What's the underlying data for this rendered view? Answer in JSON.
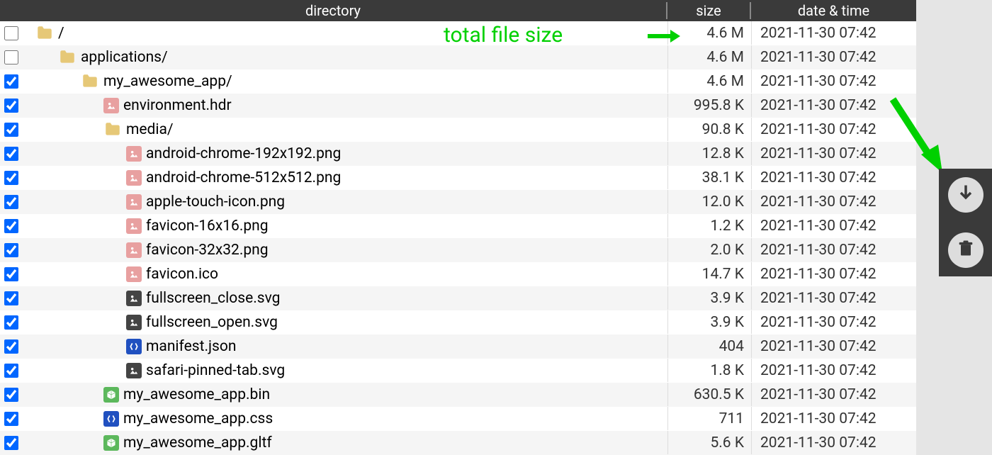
{
  "header": {
    "directory": "directory",
    "size": "size",
    "date": "date & time"
  },
  "annotation": {
    "total_label": "total file size"
  },
  "rows": [
    {
      "checked": false,
      "depth": 0,
      "icon": "folder",
      "name": "/",
      "size": "4.6 M",
      "date": "2021-11-30 07:42"
    },
    {
      "checked": false,
      "depth": 1,
      "icon": "folder",
      "name": "applications/",
      "size": "4.6 M",
      "date": "2021-11-30 07:42"
    },
    {
      "checked": true,
      "depth": 2,
      "icon": "folder",
      "name": "my_awesome_app/",
      "size": "4.6 M",
      "date": "2021-11-30 07:42"
    },
    {
      "checked": true,
      "depth": 3,
      "icon": "image",
      "name": "environment.hdr",
      "size": "995.8 K",
      "date": "2021-11-30 07:42"
    },
    {
      "checked": true,
      "depth": 3,
      "icon": "folder",
      "name": "media/",
      "size": "90.8 K",
      "date": "2021-11-30 07:42"
    },
    {
      "checked": true,
      "depth": 4,
      "icon": "image",
      "name": "android-chrome-192x192.png",
      "size": "12.8 K",
      "date": "2021-11-30 07:42"
    },
    {
      "checked": true,
      "depth": 4,
      "icon": "image",
      "name": "android-chrome-512x512.png",
      "size": "38.1 K",
      "date": "2021-11-30 07:42"
    },
    {
      "checked": true,
      "depth": 4,
      "icon": "image",
      "name": "apple-touch-icon.png",
      "size": "12.0 K",
      "date": "2021-11-30 07:42"
    },
    {
      "checked": true,
      "depth": 4,
      "icon": "image",
      "name": "favicon-16x16.png",
      "size": "1.2 K",
      "date": "2021-11-30 07:42"
    },
    {
      "checked": true,
      "depth": 4,
      "icon": "image",
      "name": "favicon-32x32.png",
      "size": "2.0 K",
      "date": "2021-11-30 07:42"
    },
    {
      "checked": true,
      "depth": 4,
      "icon": "image",
      "name": "favicon.ico",
      "size": "14.7 K",
      "date": "2021-11-30 07:42"
    },
    {
      "checked": true,
      "depth": 4,
      "icon": "svg",
      "name": "fullscreen_close.svg",
      "size": "3.9 K",
      "date": "2021-11-30 07:42"
    },
    {
      "checked": true,
      "depth": 4,
      "icon": "svg",
      "name": "fullscreen_open.svg",
      "size": "3.9 K",
      "date": "2021-11-30 07:42"
    },
    {
      "checked": true,
      "depth": 4,
      "icon": "json",
      "name": "manifest.json",
      "size": "404",
      "date": "2021-11-30 07:42"
    },
    {
      "checked": true,
      "depth": 4,
      "icon": "svg",
      "name": "safari-pinned-tab.svg",
      "size": "1.8 K",
      "date": "2021-11-30 07:42"
    },
    {
      "checked": true,
      "depth": 3,
      "icon": "bin",
      "name": "my_awesome_app.bin",
      "size": "630.5 K",
      "date": "2021-11-30 07:42"
    },
    {
      "checked": true,
      "depth": 3,
      "icon": "css",
      "name": "my_awesome_app.css",
      "size": "711",
      "date": "2021-11-30 07:42"
    },
    {
      "checked": true,
      "depth": 3,
      "icon": "gltf",
      "name": "my_awesome_app.gltf",
      "size": "5.6 K",
      "date": "2021-11-30 07:42"
    }
  ]
}
